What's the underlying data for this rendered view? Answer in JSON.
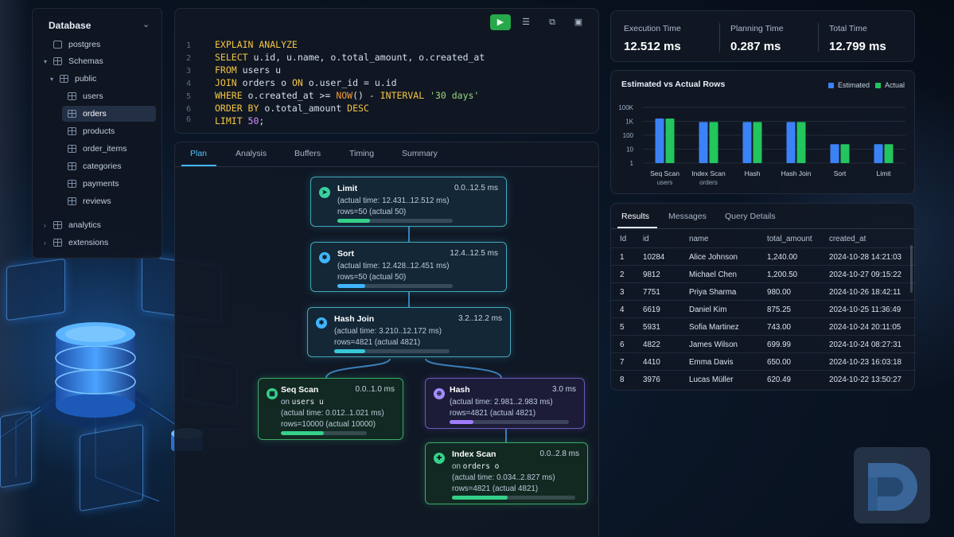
{
  "sidebar": {
    "title": "Database",
    "items": [
      {
        "label": "postgres"
      },
      {
        "label": "Schemas"
      },
      {
        "label": "public"
      },
      {
        "label": "users"
      },
      {
        "label": "orders"
      },
      {
        "label": "products"
      },
      {
        "label": "order_items"
      },
      {
        "label": "categories"
      },
      {
        "label": "payments"
      },
      {
        "label": "reviews"
      },
      {
        "label": "analytics"
      },
      {
        "label": "extensions"
      }
    ]
  },
  "editor": {
    "line_numbers": [
      "1",
      "2",
      "3",
      "4",
      "5",
      "6"
    ],
    "lines": [
      {
        "kw": "EXPLAIN ANALYZE",
        "rest": ""
      },
      {
        "kw": "SELECT",
        "rest": " u.id, u.name, o.total_amount, o.created_at"
      },
      {
        "kw": "FROM",
        "rest": " users u"
      },
      {
        "kw": "JOIN",
        "rest": " orders o ",
        "kw2": "ON",
        "rest2": " o.user_id = u.id"
      },
      {
        "kw": "WHERE",
        "rest": " o.created_at >= ",
        "fn": "NOW",
        "rest2": "() - ",
        "kw2": "INTERVAL",
        "str": " '30 days'"
      },
      {
        "kw": "ORDER BY",
        "rest": " o.total_amount ",
        "kw2": "DESC"
      },
      {
        "kw": "LIMIT",
        "num": " 50",
        "rest": ";"
      }
    ]
  },
  "plan_tabs": [
    "Plan",
    "Analysis",
    "Buffers",
    "Timing",
    "Summary"
  ],
  "plan_nodes": {
    "limit": {
      "title": "Limit",
      "time": "0.0..12.5 ms",
      "actual": "(actual time: 12.431..12.512 ms)",
      "rows": "rows=50 (actual 50)",
      "progress": 0.28
    },
    "sort": {
      "title": "Sort",
      "time": "12.4..12.5 ms",
      "actual": "(actual time: 12.428..12.451 ms)",
      "rows": "rows=50 (actual 50)",
      "progress": 0.24
    },
    "hashjoin": {
      "title": "Hash Join",
      "time": "3.2..12.2 ms",
      "actual": "(actual time: 3.210..12.172 ms)",
      "rows": "rows=4821 (actual 4821)",
      "progress": 0.27
    },
    "seqscan": {
      "title": "Seq Scan",
      "time": "0.0..1.0 ms",
      "on_prefix": "on ",
      "on_table": "users u",
      "actual": "(actual time: 0.012..1.021 ms)",
      "rows": "rows=10000 (actual 10000)",
      "progress": 0.5
    },
    "hash": {
      "title": "Hash",
      "time": "3.0 ms",
      "actual": "(actual time: 2.981..2.983 ms)",
      "rows": "rows=4821 (actual 4821)",
      "progress": 0.2
    },
    "indexscan": {
      "title": "Index Scan",
      "time": "0.0..2.8 ms",
      "on_prefix": "on ",
      "on_table": "orders o",
      "actual": "(actual time: 0.034..2.827 ms)",
      "rows": "rows=4821 (actual 4821)",
      "progress": 0.45
    }
  },
  "metrics": [
    {
      "label": "Execution Time",
      "value": "12.512 ms"
    },
    {
      "label": "Planning Time",
      "value": "0.287 ms"
    },
    {
      "label": "Total Time",
      "value": "12.799 ms"
    }
  ],
  "chart_data": {
    "type": "bar",
    "title": "Estimated vs Actual Rows",
    "y_scale": "log",
    "ylim": [
      1,
      100000
    ],
    "y_ticks": [
      "100K",
      "1K",
      "100",
      "10",
      "1"
    ],
    "categories": [
      "Seq Scan",
      "Index Scan",
      "Hash",
      "Hash Join",
      "Sort",
      "Limit"
    ],
    "sublabels": [
      "users",
      "orders",
      "",
      "",
      "",
      ""
    ],
    "series": [
      {
        "name": "Estimated",
        "values": [
          10000,
          4821,
          4821,
          4821,
          50,
          50
        ]
      },
      {
        "name": "Actual",
        "values": [
          10000,
          4821,
          4821,
          4821,
          50,
          50
        ]
      }
    ],
    "legend_position": "top-right",
    "colors": {
      "Estimated": "#3b82f6",
      "Actual": "#22c55e"
    }
  },
  "results": {
    "tabs": [
      "Results",
      "Messages",
      "Query Details"
    ],
    "columns": [
      "Id",
      "id",
      "name",
      "total_amount",
      "created_at"
    ],
    "rows": [
      [
        "1",
        "10284",
        "Alice Johnson",
        "1,240.00",
        "2024-10-28 14:21:03"
      ],
      [
        "2",
        "9812",
        "Michael Chen",
        "1,200.50",
        "2024-10-27 09:15:22"
      ],
      [
        "3",
        "7751",
        "Priya Sharma",
        "980.00",
        "2024-10-26 18:42:11"
      ],
      [
        "4",
        "6619",
        "Daniel Kim",
        "875.25",
        "2024-10-25 11:36:49"
      ],
      [
        "5",
        "5931",
        "Sofia Martinez",
        "743.00",
        "2024-10-24 20:11:05"
      ],
      [
        "6",
        "4822",
        "James Wilson",
        "699.99",
        "2024-10-24 08:27:31"
      ],
      [
        "7",
        "4410",
        "Emma Davis",
        "650.00",
        "2024-10-23 16:03:18"
      ],
      [
        "8",
        "3976",
        "Lucas Müller",
        "620.49",
        "2024-10-22 13:50:27"
      ]
    ]
  },
  "colors": {
    "accent": "#3fb5ff",
    "run_button": "#27a84a",
    "teal_node": "#45a7b8",
    "green_node": "#3daa6b",
    "purple_node": "#6a5bb8"
  },
  "icons": {
    "run": "play-icon",
    "format": "list-icon",
    "explain": "export-icon",
    "save": "save-icon",
    "logo": "d-logo"
  }
}
